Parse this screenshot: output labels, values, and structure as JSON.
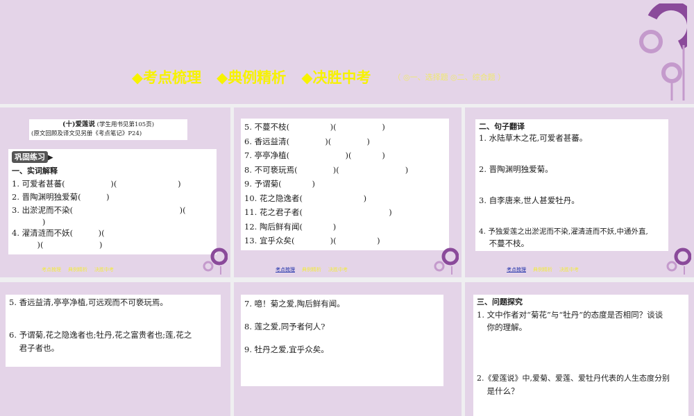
{
  "header": {
    "nav": [
      "◆考点梳理",
      "◆典例精析",
      "◆决胜中考"
    ],
    "sub": "（  ◎一、选择题    ◎二、综合题  ）"
  },
  "footer": {
    "items": [
      "考点梳理",
      "典例精析",
      "决胜中考"
    ]
  },
  "p1": {
    "title": "(十)爱莲说",
    "title_note": "(学生用书见第105页)",
    "ref": "(原文回顾及译文见另册《考点笔记》P24)",
    "tag": "巩固练习",
    "section": "一、实词解释",
    "items": [
      "1. 可爱者甚蕃(                  )(                        )",
      "2. 晋陶渊明独爱菊(          )",
      "3. 出淤泥而不染(                                          )(",
      "            )",
      "4. 濯清涟而不妖(          )(",
      "          )(                      )"
    ]
  },
  "p2": {
    "items": [
      "5. 不蔓不枝(                )(                  )",
      "6. 香远益清(              )(              )",
      "7. 亭亭净植(                      )(            )",
      "8. 不可亵玩焉(              )(                          )",
      "9. 予谓菊(            )",
      "10. 花之隐逸者(                        )",
      "11. 花之君子者(                                  )",
      "12. 陶后鲜有闻(            )",
      "13. 宜乎众矣(              )(                )"
    ]
  },
  "p3": {
    "section": "二、句子翻译",
    "items": [
      "1. 水陆草木之花,可爱者甚蕃。",
      "2. 晋陶渊明独爱菊。",
      "3. 自李唐来,世人甚爱牡丹。",
      "4. 予独爱莲之出淤泥而不染,濯清涟而不妖,中通外直,",
      "    不蔓不枝。"
    ]
  },
  "p4": {
    "items": [
      "5. 香远益清,亭亭净植,可远观而不可亵玩焉。",
      "6. 予谓菊,花之隐逸者也;牡丹,花之富贵者也;莲,花之",
      "    君子者也。"
    ]
  },
  "p5": {
    "items": [
      "7. 噫！菊之爱,陶后鲜有闻。",
      "8. 莲之爱,同予者何人?",
      "9. 牡丹之爱,宜乎众矣。"
    ]
  },
  "p6": {
    "section": "三、问题探究",
    "items": [
      "1. 文中作者对“菊花”与“牡丹”的态度是否相同？谈谈",
      "    你的理解。",
      "2.《爱莲说》中,爱菊、爱莲、爱牡丹代表的人生态度分别",
      "    是什么？"
    ]
  }
}
